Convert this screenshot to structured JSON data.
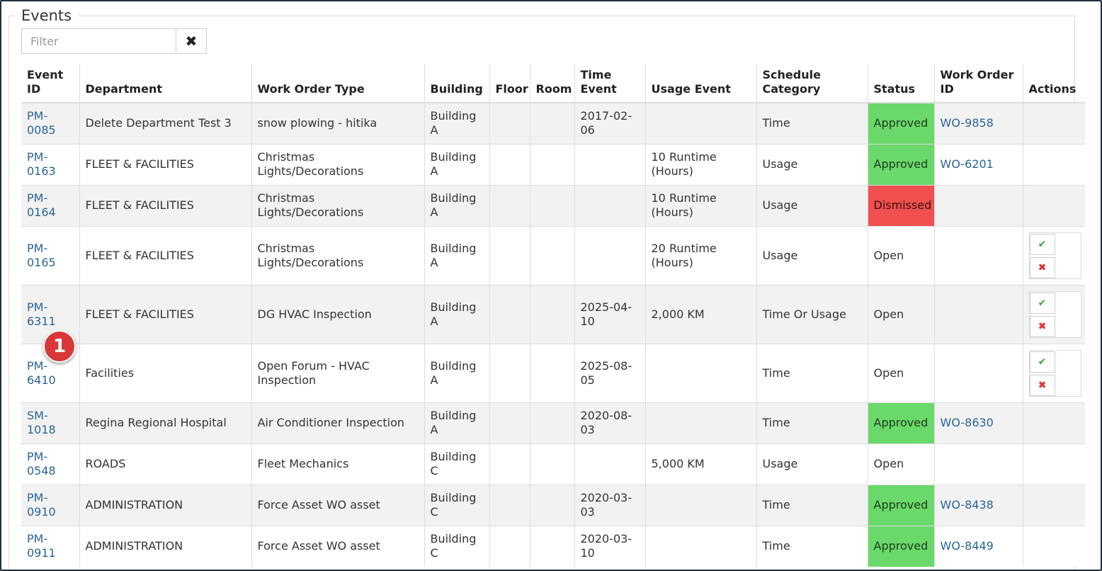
{
  "panel": {
    "title": "Events"
  },
  "filter": {
    "placeholder": "Filter",
    "value": "",
    "clear_icon": "✖"
  },
  "table": {
    "columns": [
      "Event ID",
      "Department",
      "Work Order Type",
      "Building",
      "Floor",
      "Room",
      "Time Event",
      "Usage Event",
      "Schedule Category",
      "Status",
      "Work Order ID",
      "Actions"
    ],
    "rows": [
      {
        "event_id": "PM-0085",
        "department": "Delete Department Test 3",
        "work_order_type": "snow plowing - hitika",
        "building": "Building A",
        "floor": "",
        "room": "",
        "time_event": "2017-02-06",
        "usage_event": "",
        "schedule_category": "Time",
        "status": "Approved",
        "work_order_id": "WO-9858",
        "has_actions": false
      },
      {
        "event_id": "PM-0163",
        "department": "FLEET & FACILITIES",
        "work_order_type": "Christmas Lights/Decorations",
        "building": "Building A",
        "floor": "",
        "room": "",
        "time_event": "",
        "usage_event": "10 Runtime (Hours)",
        "schedule_category": "Usage",
        "status": "Approved",
        "work_order_id": "WO-6201",
        "has_actions": false
      },
      {
        "event_id": "PM-0164",
        "department": "FLEET & FACILITIES",
        "work_order_type": "Christmas Lights/Decorations",
        "building": "Building A",
        "floor": "",
        "room": "",
        "time_event": "",
        "usage_event": "10 Runtime (Hours)",
        "schedule_category": "Usage",
        "status": "Dismissed",
        "work_order_id": "",
        "has_actions": false
      },
      {
        "event_id": "PM-0165",
        "department": "FLEET & FACILITIES",
        "work_order_type": "Christmas Lights/Decorations",
        "building": "Building A",
        "floor": "",
        "room": "",
        "time_event": "",
        "usage_event": "20 Runtime (Hours)",
        "schedule_category": "Usage",
        "status": "Open",
        "work_order_id": "",
        "has_actions": true
      },
      {
        "event_id": "PM-6311",
        "department": "FLEET & FACILITIES",
        "work_order_type": "DG HVAC Inspection",
        "building": "Building A",
        "floor": "",
        "room": "",
        "time_event": "2025-04-10",
        "usage_event": "2,000 KM",
        "schedule_category": "Time Or Usage",
        "status": "Open",
        "work_order_id": "",
        "has_actions": true
      },
      {
        "event_id": "PM-6410",
        "department": "Facilities",
        "work_order_type": "Open Forum - HVAC Inspection",
        "building": "Building A",
        "floor": "",
        "room": "",
        "time_event": "2025-08-05",
        "usage_event": "",
        "schedule_category": "Time",
        "status": "Open",
        "work_order_id": "",
        "has_actions": true
      },
      {
        "event_id": "SM-1018",
        "department": "Regina Regional Hospital",
        "work_order_type": "Air Conditioner Inspection",
        "building": "Building A",
        "floor": "",
        "room": "",
        "time_event": "2020-08-03",
        "usage_event": "",
        "schedule_category": "Time",
        "status": "Approved",
        "work_order_id": "WO-8630",
        "has_actions": false
      },
      {
        "event_id": "PM-0548",
        "department": "ROADS",
        "work_order_type": "Fleet Mechanics",
        "building": "Building C",
        "floor": "",
        "room": "",
        "time_event": "",
        "usage_event": "5,000 KM",
        "schedule_category": "Usage",
        "status": "Open",
        "work_order_id": "",
        "has_actions": false
      },
      {
        "event_id": "PM-0910",
        "department": "ADMINISTRATION",
        "work_order_type": "Force Asset WO asset",
        "building": "Building C",
        "floor": "",
        "room": "",
        "time_event": "2020-03-03",
        "usage_event": "",
        "schedule_category": "Time",
        "status": "Approved",
        "work_order_id": "WO-8438",
        "has_actions": false
      },
      {
        "event_id": "PM-0911",
        "department": "ADMINISTRATION",
        "work_order_type": "Force Asset WO asset",
        "building": "Building C",
        "floor": "",
        "room": "",
        "time_event": "2020-03-10",
        "usage_event": "",
        "schedule_category": "Time",
        "status": "Approved",
        "work_order_id": "WO-8449",
        "has_actions": false
      }
    ]
  },
  "actions": {
    "approve_icon": "✔",
    "dismiss_icon": "✖"
  },
  "annotation": {
    "badge_label": "1"
  },
  "colors": {
    "approved": "#6ad86a",
    "dismissed": "#f05050",
    "link": "#2a6496",
    "badge": "#d93838"
  }
}
